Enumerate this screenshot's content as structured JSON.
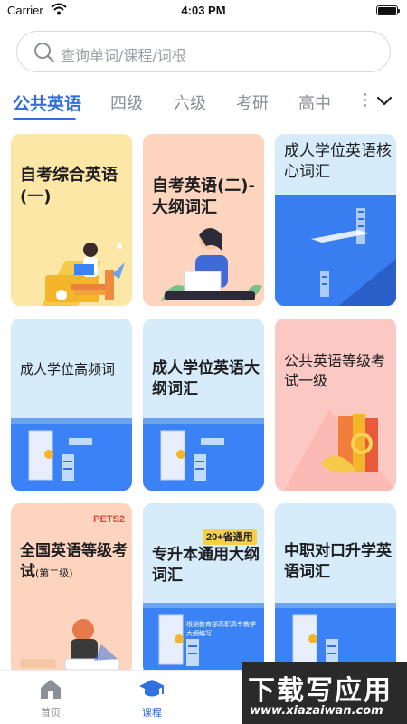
{
  "status_bar": {
    "carrier": "Carrier",
    "time": "4:03 PM"
  },
  "search": {
    "placeholder": "查询单词/课程/词根"
  },
  "tabs": [
    "公共英语",
    "四级",
    "六级",
    "考研",
    "高中"
  ],
  "cards": [
    {
      "title": "自考综合英语(一)"
    },
    {
      "title": "自考英语(二)-大纲词汇"
    },
    {
      "title": "成人学位英语核心词汇"
    },
    {
      "title": "成人学位高频词"
    },
    {
      "title": "成人学位英语大纲词汇"
    },
    {
      "title": "公共英语等级考试一级"
    },
    {
      "title": "全国英语等级考试",
      "subtitle": "(第二级)",
      "tag": "PETS2"
    },
    {
      "title": "专升本通用大纲词汇",
      "tag": "20+省通用",
      "note": "根据教育部高职高专教学大纲编写"
    },
    {
      "title": "中职对口升学英语词汇"
    }
  ],
  "bottom_nav": [
    {
      "label": "首页"
    },
    {
      "label": "课程"
    }
  ],
  "watermark": {
    "main": "下载写应用",
    "url": "www.xiazaiwan.com"
  },
  "colors": {
    "accent": "#2f6fe0",
    "card_yellow": "#fde7a6",
    "card_peach": "#fdd5bf",
    "card_blue": "#d6ecfb",
    "card_pink": "#fcc8c4"
  }
}
